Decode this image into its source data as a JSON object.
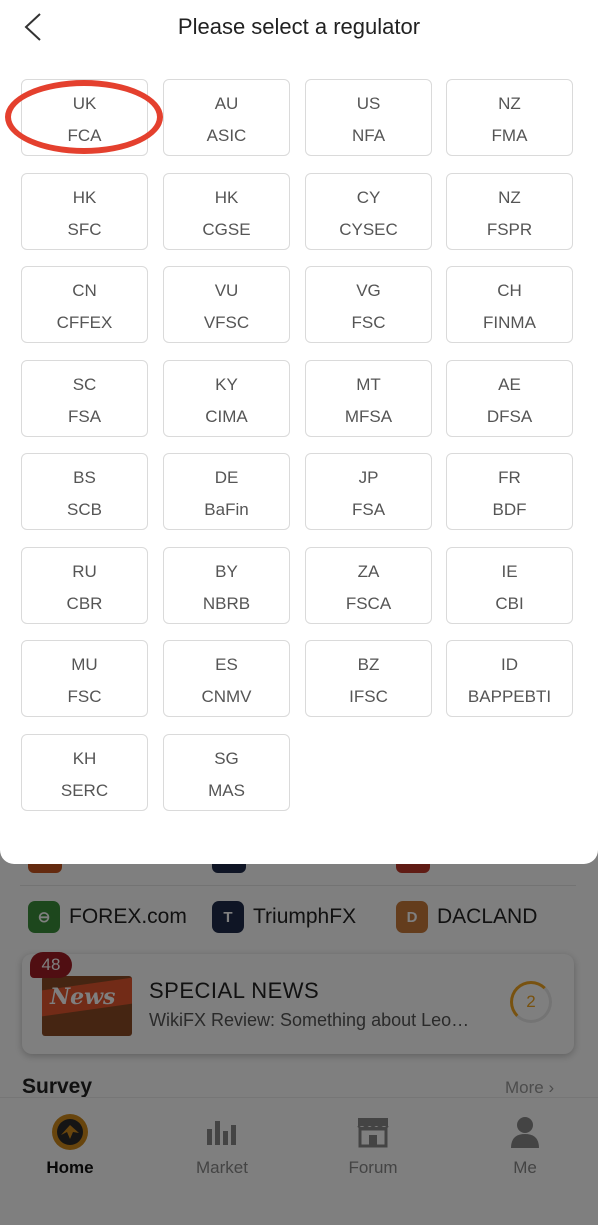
{
  "header": {
    "title": "Please select a regulator"
  },
  "regulators": [
    {
      "country": "UK",
      "code": "FCA"
    },
    {
      "country": "AU",
      "code": "ASIC"
    },
    {
      "country": "US",
      "code": "NFA"
    },
    {
      "country": "NZ",
      "code": "FMA"
    },
    {
      "country": "HK",
      "code": "SFC"
    },
    {
      "country": "HK",
      "code": "CGSE"
    },
    {
      "country": "CY",
      "code": "CYSEC"
    },
    {
      "country": "NZ",
      "code": "FSPR"
    },
    {
      "country": "CN",
      "code": "CFFEX"
    },
    {
      "country": "VU",
      "code": "VFSC"
    },
    {
      "country": "VG",
      "code": "FSC"
    },
    {
      "country": "CH",
      "code": "FINMA"
    },
    {
      "country": "SC",
      "code": "FSA"
    },
    {
      "country": "KY",
      "code": "CIMA"
    },
    {
      "country": "MT",
      "code": "MFSA"
    },
    {
      "country": "AE",
      "code": "DFSA"
    },
    {
      "country": "BS",
      "code": "SCB"
    },
    {
      "country": "DE",
      "code": "BaFin"
    },
    {
      "country": "JP",
      "code": "FSA"
    },
    {
      "country": "FR",
      "code": "BDF"
    },
    {
      "country": "RU",
      "code": "CBR"
    },
    {
      "country": "BY",
      "code": "NBRB"
    },
    {
      "country": "ZA",
      "code": "FSCA"
    },
    {
      "country": "IE",
      "code": "CBI"
    },
    {
      "country": "MU",
      "code": "FSC"
    },
    {
      "country": "ES",
      "code": "CNMV"
    },
    {
      "country": "BZ",
      "code": "IFSC"
    },
    {
      "country": "ID",
      "code": "BAPPEBTI"
    },
    {
      "country": "KH",
      "code": "SERC"
    },
    {
      "country": "SG",
      "code": "MAS"
    }
  ],
  "brokers": [
    {
      "name": "FOREX.com",
      "color": "#3a8f3a",
      "icon": "forex-logo"
    },
    {
      "name": "TriumphFX",
      "color": "#1f2a4a",
      "icon": "triumphfx-logo"
    },
    {
      "name": "DACLAND",
      "color": "#c87a3a",
      "icon": "dacland-logo"
    }
  ],
  "news": {
    "badge": "48",
    "image_word": "News",
    "title": "SPECIAL NEWS",
    "subtitle": "WikiFX Review: Something about Leo…",
    "count": "2"
  },
  "section": {
    "title": "Survey",
    "more": "More"
  },
  "tabs": [
    {
      "label": "Home",
      "icon": "home-eagle-icon",
      "active": true
    },
    {
      "label": "Market",
      "icon": "bar-chart-icon",
      "active": false
    },
    {
      "label": "Forum",
      "icon": "store-icon",
      "active": false
    },
    {
      "label": "Me",
      "icon": "person-icon",
      "active": false
    }
  ],
  "colors": {
    "highlight": "#e4402e",
    "accent": "#f0a520",
    "badge": "#a11d24"
  }
}
